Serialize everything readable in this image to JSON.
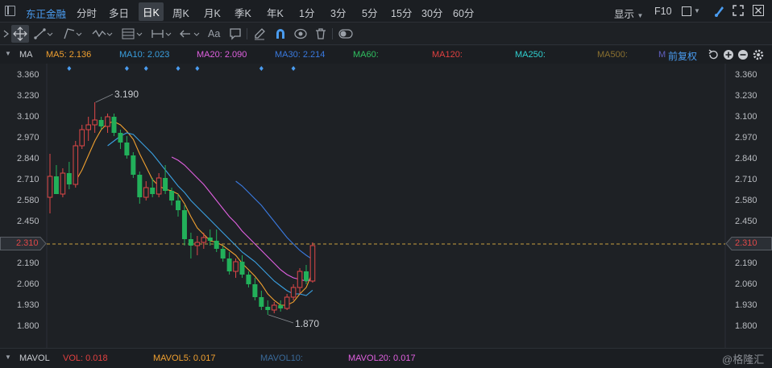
{
  "topbar": {
    "stock_name": "东正金融",
    "tabs": [
      "分时",
      "多日",
      "日K",
      "周K",
      "月K",
      "季K",
      "年K",
      "1分",
      "3分",
      "5分",
      "15分",
      "30分",
      "60分"
    ],
    "active_tab": "日K",
    "display_label": "显示",
    "f10_label": "F10"
  },
  "toolbar": {
    "text_tool": "Aa"
  },
  "ma_line": {
    "label": "MA",
    "items": [
      {
        "text": "MA5: 2.136",
        "color": "#f0a030"
      },
      {
        "text": "MA10: 2.023",
        "color": "#3aa0e0"
      },
      {
        "text": "MA20: 2.090",
        "color": "#e060e0"
      },
      {
        "text": "MA30: 2.214",
        "color": "#3a7ae0"
      },
      {
        "text": "MA60:",
        "color": "#30c060"
      },
      {
        "text": "MA120:",
        "color": "#e04040"
      },
      {
        "text": "MA250:",
        "color": "#30d0d0"
      },
      {
        "text": "MA500:",
        "color": "#8a7030"
      },
      {
        "text": "M",
        "color": "#6060c0"
      }
    ],
    "adjust_label": "前复权"
  },
  "y_axis": {
    "ticks": [
      "3.360",
      "3.230",
      "3.100",
      "2.970",
      "2.840",
      "2.710",
      "2.580",
      "2.450",
      "2.310",
      "2.190",
      "2.060",
      "1.930",
      "1.800"
    ],
    "current_price": "2.310"
  },
  "annotations": {
    "high": "3.190",
    "low": "1.870"
  },
  "vol_line": {
    "label": "MAVOL",
    "items": [
      {
        "text": "VOL: 0.018",
        "color": "#e04040"
      },
      {
        "text": "MAVOL5: 0.017",
        "color": "#f0a030"
      },
      {
        "text": "MAVOL10:",
        "color": "#3a6a9a"
      },
      {
        "text": "MAVOL20: 0.017",
        "color": "#e060e0"
      }
    ]
  },
  "watermark": "@格隆汇",
  "colors": {
    "up": "#e04848",
    "down": "#22b05a",
    "ma5": "#f0a030",
    "ma10": "#3aa0e0",
    "ma20": "#e060e0",
    "ma30": "#3a7ae0"
  },
  "chart_data": {
    "type": "candlestick",
    "y_range": [
      1.8,
      3.36
    ],
    "candles": [
      {
        "o": 2.6,
        "h": 2.87,
        "l": 2.5,
        "c": 2.73
      },
      {
        "o": 2.73,
        "h": 2.8,
        "l": 2.62,
        "c": 2.62
      },
      {
        "o": 2.62,
        "h": 2.78,
        "l": 2.6,
        "c": 2.75
      },
      {
        "o": 2.75,
        "h": 2.82,
        "l": 2.65,
        "c": 2.68
      },
      {
        "o": 2.68,
        "h": 2.95,
        "l": 2.66,
        "c": 2.92
      },
      {
        "o": 2.92,
        "h": 3.05,
        "l": 2.9,
        "c": 3.02
      },
      {
        "o": 3.02,
        "h": 3.1,
        "l": 2.95,
        "c": 3.05
      },
      {
        "o": 3.05,
        "h": 3.19,
        "l": 3.0,
        "c": 3.08
      },
      {
        "o": 3.08,
        "h": 3.1,
        "l": 3.02,
        "c": 3.04
      },
      {
        "o": 3.04,
        "h": 3.12,
        "l": 3.0,
        "c": 3.1
      },
      {
        "o": 3.1,
        "h": 3.12,
        "l": 2.98,
        "c": 3.0
      },
      {
        "o": 3.0,
        "h": 3.02,
        "l": 2.9,
        "c": 2.94
      },
      {
        "o": 2.94,
        "h": 2.98,
        "l": 2.84,
        "c": 2.86
      },
      {
        "o": 2.86,
        "h": 2.88,
        "l": 2.72,
        "c": 2.74
      },
      {
        "o": 2.74,
        "h": 2.76,
        "l": 2.56,
        "c": 2.6
      },
      {
        "o": 2.6,
        "h": 2.7,
        "l": 2.58,
        "c": 2.66
      },
      {
        "o": 2.66,
        "h": 2.72,
        "l": 2.6,
        "c": 2.62
      },
      {
        "o": 2.62,
        "h": 2.75,
        "l": 2.6,
        "c": 2.72
      },
      {
        "o": 2.72,
        "h": 2.8,
        "l": 2.62,
        "c": 2.64
      },
      {
        "o": 2.64,
        "h": 2.66,
        "l": 2.55,
        "c": 2.58
      },
      {
        "o": 2.58,
        "h": 2.62,
        "l": 2.48,
        "c": 2.52
      },
      {
        "o": 2.52,
        "h": 2.55,
        "l": 2.3,
        "c": 2.34
      },
      {
        "o": 2.34,
        "h": 2.38,
        "l": 2.22,
        "c": 2.3
      },
      {
        "o": 2.3,
        "h": 2.36,
        "l": 2.24,
        "c": 2.32
      },
      {
        "o": 2.32,
        "h": 2.38,
        "l": 2.28,
        "c": 2.35
      },
      {
        "o": 2.35,
        "h": 2.4,
        "l": 2.3,
        "c": 2.33
      },
      {
        "o": 2.33,
        "h": 2.4,
        "l": 2.26,
        "c": 2.28
      },
      {
        "o": 2.28,
        "h": 2.3,
        "l": 2.2,
        "c": 2.22
      },
      {
        "o": 2.22,
        "h": 2.26,
        "l": 2.12,
        "c": 2.14
      },
      {
        "o": 2.14,
        "h": 2.22,
        "l": 2.1,
        "c": 2.2
      },
      {
        "o": 2.2,
        "h": 2.24,
        "l": 2.1,
        "c": 2.12
      },
      {
        "o": 2.12,
        "h": 2.14,
        "l": 2.04,
        "c": 2.06
      },
      {
        "o": 2.06,
        "h": 2.1,
        "l": 1.96,
        "c": 1.98
      },
      {
        "o": 1.98,
        "h": 2.02,
        "l": 1.9,
        "c": 1.92
      },
      {
        "o": 1.92,
        "h": 1.96,
        "l": 1.87,
        "c": 1.9
      },
      {
        "o": 1.9,
        "h": 1.95,
        "l": 1.88,
        "c": 1.93
      },
      {
        "o": 1.93,
        "h": 1.96,
        "l": 1.89,
        "c": 1.91
      },
      {
        "o": 1.91,
        "h": 2.0,
        "l": 1.9,
        "c": 1.98
      },
      {
        "o": 1.98,
        "h": 2.06,
        "l": 1.96,
        "c": 2.04
      },
      {
        "o": 2.04,
        "h": 2.16,
        "l": 2.0,
        "c": 2.14
      },
      {
        "o": 2.14,
        "h": 2.18,
        "l": 2.06,
        "c": 2.08
      },
      {
        "o": 2.08,
        "h": 2.32,
        "l": 2.07,
        "c": 2.3
      }
    ],
    "ma": {
      "ma5": [
        null,
        null,
        null,
        null,
        2.7,
        2.77,
        2.86,
        2.95,
        3.02,
        3.06,
        3.07,
        3.05,
        3.01,
        2.96,
        2.87,
        2.79,
        2.71,
        2.67,
        2.65,
        2.64,
        2.62,
        2.56,
        2.48,
        2.41,
        2.37,
        2.33,
        2.32,
        2.3,
        2.27,
        2.24,
        2.19,
        2.15,
        2.11,
        2.06,
        2.0,
        1.96,
        1.93,
        1.93,
        1.95,
        2.0,
        2.04,
        2.136
      ],
      "ma10": [
        null,
        null,
        null,
        null,
        null,
        null,
        null,
        null,
        null,
        2.92,
        2.95,
        2.98,
        3.0,
        2.99,
        2.95,
        2.91,
        2.87,
        2.82,
        2.77,
        2.72,
        2.67,
        2.63,
        2.58,
        2.54,
        2.5,
        2.46,
        2.42,
        2.38,
        2.34,
        2.3,
        2.26,
        2.23,
        2.2,
        2.16,
        2.12,
        2.08,
        2.05,
        2.02,
        2.0,
        2.0,
        1.99,
        2.023
      ],
      "ma20": [
        null,
        null,
        null,
        null,
        null,
        null,
        null,
        null,
        null,
        null,
        null,
        null,
        null,
        null,
        null,
        null,
        null,
        null,
        null,
        2.85,
        2.83,
        2.8,
        2.76,
        2.72,
        2.68,
        2.63,
        2.58,
        2.53,
        2.48,
        2.44,
        2.39,
        2.35,
        2.31,
        2.27,
        2.23,
        2.19,
        2.15,
        2.12,
        2.1,
        2.09,
        2.08,
        2.09
      ],
      "ma30": [
        null,
        null,
        null,
        null,
        null,
        null,
        null,
        null,
        null,
        null,
        null,
        null,
        null,
        null,
        null,
        null,
        null,
        null,
        null,
        null,
        null,
        null,
        null,
        null,
        null,
        null,
        null,
        null,
        null,
        2.7,
        2.67,
        2.63,
        2.59,
        2.55,
        2.5,
        2.45,
        2.4,
        2.35,
        2.31,
        2.27,
        2.24,
        2.214
      ]
    }
  }
}
